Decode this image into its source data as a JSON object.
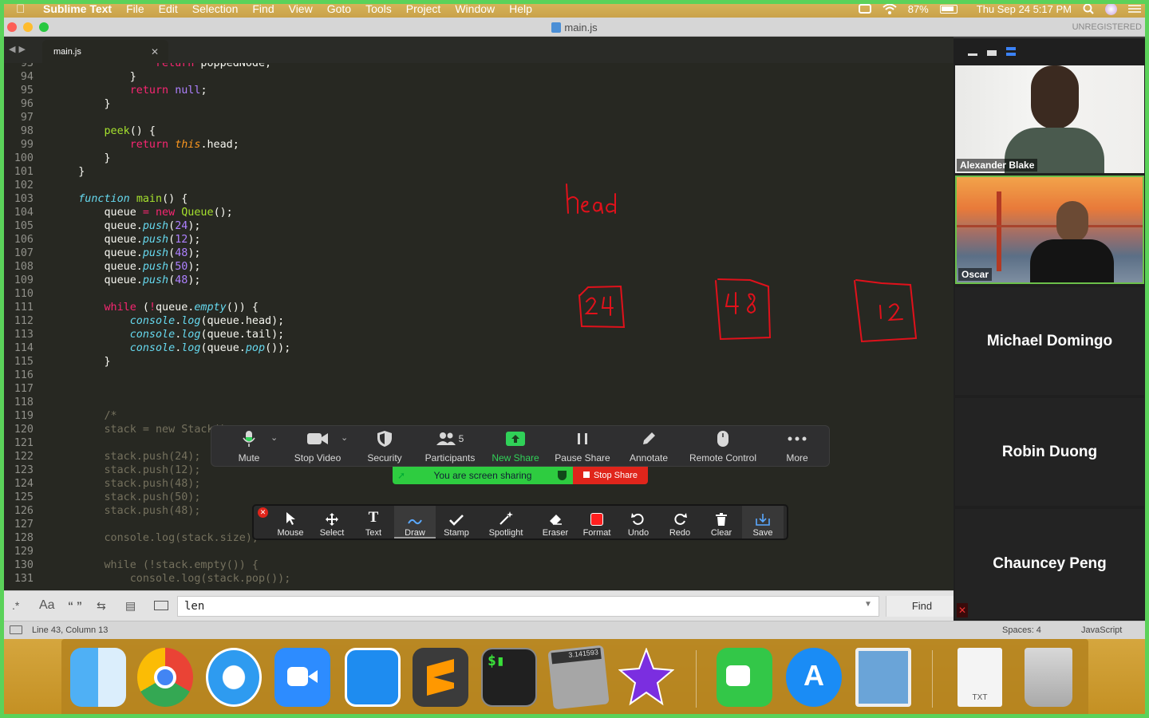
{
  "menubar": {
    "app_name": "Sublime Text",
    "items": [
      "File",
      "Edit",
      "Selection",
      "Find",
      "View",
      "Goto",
      "Tools",
      "Project",
      "Window",
      "Help"
    ],
    "battery": "87%",
    "datetime": "Thu Sep 24  5:17 PM"
  },
  "window": {
    "title": "main.js",
    "registration": "UNREGISTERED",
    "tab_label": "main.js"
  },
  "editor": {
    "lines": [
      {
        "n": "93",
        "t": "                return poppedNode;"
      },
      {
        "n": "94",
        "t": "            }"
      },
      {
        "n": "95",
        "t": "            return null;"
      },
      {
        "n": "96",
        "t": "        }"
      },
      {
        "n": "97",
        "t": ""
      },
      {
        "n": "98",
        "t": "        peek() {"
      },
      {
        "n": "99",
        "t": "            return this.head;"
      },
      {
        "n": "100",
        "t": "        }"
      },
      {
        "n": "101",
        "t": "    }"
      },
      {
        "n": "102",
        "t": ""
      },
      {
        "n": "103",
        "t": "    function main() {"
      },
      {
        "n": "104",
        "t": "        queue = new Queue();"
      },
      {
        "n": "105",
        "t": "        queue.push(24);"
      },
      {
        "n": "106",
        "t": "        queue.push(12);"
      },
      {
        "n": "107",
        "t": "        queue.push(48);"
      },
      {
        "n": "108",
        "t": "        queue.push(50);"
      },
      {
        "n": "109",
        "t": "        queue.push(48);"
      },
      {
        "n": "110",
        "t": ""
      },
      {
        "n": "111",
        "t": "        while (!queue.empty()) {"
      },
      {
        "n": "112",
        "t": "            console.log(queue.head);"
      },
      {
        "n": "113",
        "t": "            console.log(queue.tail);"
      },
      {
        "n": "114",
        "t": "            console.log(queue.pop());"
      },
      {
        "n": "115",
        "t": "        }"
      },
      {
        "n": "116",
        "t": ""
      },
      {
        "n": "117",
        "t": ""
      },
      {
        "n": "118",
        "t": ""
      },
      {
        "n": "119",
        "t": "        /*"
      },
      {
        "n": "120",
        "t": "        stack = new Stack();"
      },
      {
        "n": "121",
        "t": ""
      },
      {
        "n": "122",
        "t": "        stack.push(24);"
      },
      {
        "n": "123",
        "t": "        stack.push(12);"
      },
      {
        "n": "124",
        "t": "        stack.push(48);"
      },
      {
        "n": "125",
        "t": "        stack.push(50);"
      },
      {
        "n": "126",
        "t": "        stack.push(48);"
      },
      {
        "n": "127",
        "t": ""
      },
      {
        "n": "128",
        "t": "        console.log(stack.size);"
      },
      {
        "n": "129",
        "t": ""
      },
      {
        "n": "130",
        "t": "        while (!stack.empty()) {"
      },
      {
        "n": "131",
        "t": "            console.log(stack.pop());"
      }
    ]
  },
  "annotations": {
    "head_text": "head",
    "boxes": [
      "24",
      "48",
      "12"
    ],
    "ink_color": "#e0111b"
  },
  "find_bar": {
    "regex_label": ".*",
    "case_label": "Aa",
    "word_label": "“ ”",
    "query": "len",
    "find_button": "Find"
  },
  "status_bar": {
    "position": "Line 43, Column 13",
    "spaces": "Spaces: 4",
    "syntax": "JavaScript"
  },
  "zoom": {
    "participants": [
      {
        "name": "Alexander Blake",
        "video": true
      },
      {
        "name": "Oscar",
        "video": true
      },
      {
        "name": "Michael Domingo",
        "video": false
      },
      {
        "name": "Robin Duong",
        "video": false
      },
      {
        "name": "Chauncey Peng",
        "video": false
      }
    ],
    "toolbar": {
      "mute": "Mute",
      "stop_video": "Stop Video",
      "security": "Security",
      "participants": "Participants",
      "participant_count": "5",
      "new_share": "New Share",
      "pause_share": "Pause Share",
      "annotate": "Annotate",
      "remote_control": "Remote Control",
      "more": "More"
    },
    "share_status": "You are screen sharing",
    "stop_share": "Stop Share",
    "annotate_tools": [
      "Mouse",
      "Select",
      "Text",
      "Draw",
      "Stamp",
      "Spotlight",
      "Eraser",
      "Format",
      "Undo",
      "Redo",
      "Clear",
      "Save"
    ],
    "active_tool": "Draw"
  },
  "dock": {
    "apps": [
      "Finder",
      "Chrome",
      "Safari",
      "Zoom",
      "Xcode",
      "Sublime Text",
      "Terminal",
      "Calculator",
      "iMovie",
      "FaceTime",
      "App Store",
      "Preview",
      "TXT",
      "Trash"
    ],
    "calculator_display": "3.141593",
    "txt_label": "TXT"
  },
  "colors": {
    "editor_bg": "#272822",
    "keyword": "#f92672",
    "function": "#a6e22e",
    "number": "#ae81ff",
    "builtin": "#66d9ef",
    "share_green": "#5bd25a",
    "stop_red": "#e0251b"
  }
}
